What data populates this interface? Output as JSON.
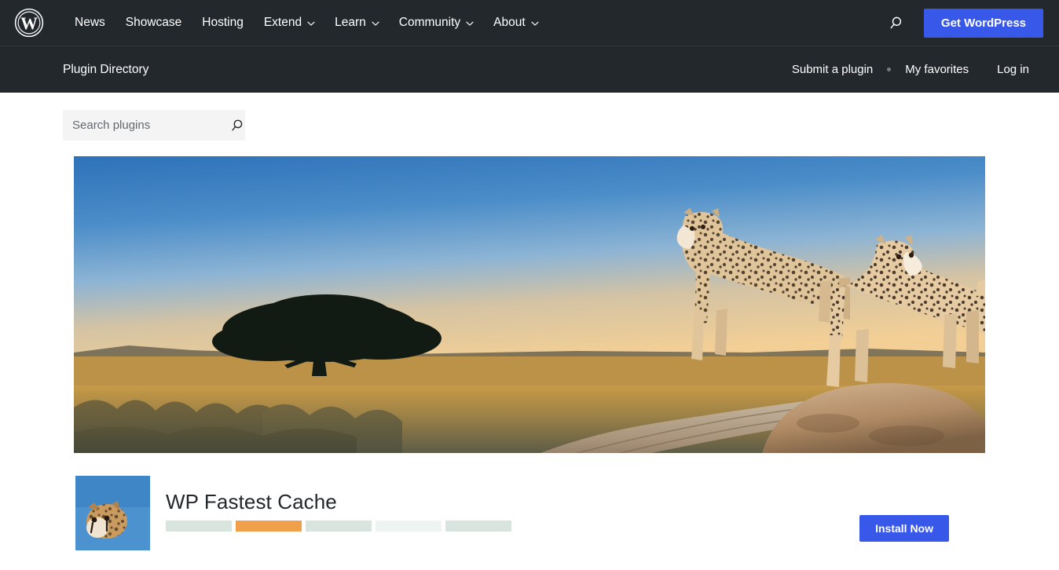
{
  "global_nav": {
    "logo_name": "wordpress-logo",
    "items": [
      {
        "label": "News",
        "has_dropdown": false
      },
      {
        "label": "Showcase",
        "has_dropdown": false
      },
      {
        "label": "Hosting",
        "has_dropdown": false
      },
      {
        "label": "Extend",
        "has_dropdown": true
      },
      {
        "label": "Learn",
        "has_dropdown": true
      },
      {
        "label": "Community",
        "has_dropdown": true
      },
      {
        "label": "About",
        "has_dropdown": true
      }
    ],
    "search_icon": "search-icon",
    "cta_label": "Get WordPress",
    "cta_color": "#3858e9",
    "background": "#23282d"
  },
  "directory_bar": {
    "title": "Plugin Directory",
    "links": [
      {
        "label": "Submit a plugin"
      },
      {
        "label": "My favorites"
      },
      {
        "label": "Log in"
      }
    ],
    "separator": "bullet",
    "background": "#23282d"
  },
  "search": {
    "placeholder": "Search plugins",
    "value": "",
    "icon": "search-icon",
    "background": "#f4f4f4"
  },
  "hero": {
    "alt": "Two cheetahs standing on a fallen log at sunset on the savanna with a lone tree silhouetted against the setting sun",
    "sky_top": "#2f74ba",
    "sky_bottom": "#f2c98a",
    "grass": "#b8933f",
    "foreground": "#6b6a52"
  },
  "plugin_card": {
    "thumb_alt": "cheetah head against blue sky",
    "title": "WP Fastest Cache",
    "rating_stars": 5,
    "install_label": "Install Now",
    "accent": "#3858e9",
    "star_color": "#f0a04b",
    "star_empty": "#d7e5de"
  }
}
